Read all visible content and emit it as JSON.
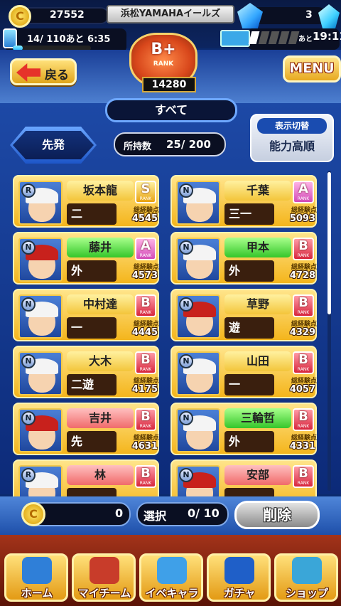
{
  "header": {
    "coins": "27552",
    "team_name": "浜松YAMAHAイールズ",
    "gems": "3",
    "stamina": "14/ 110あと 6:35",
    "stamina_fraction": 0.13,
    "ticket_prefix": "あと",
    "ticket_time": "19:11",
    "ticket_filled": 1,
    "ticket_total": 5,
    "back_label": "戻る",
    "menu_label": "MENU",
    "rank_letter": "B+",
    "rank_word": "RANK",
    "rank_score": "14280"
  },
  "filters": {
    "category": "すべて",
    "position": "先発",
    "owned_label": "所持数",
    "owned_value": "25/ 200",
    "toggle_label": "表示切替",
    "sort_label": "能力高順"
  },
  "players": [
    {
      "name": "坂本龍",
      "rank": "S",
      "pos": "二",
      "exp_label": "総経験点",
      "exp": "4545",
      "color": "yellow",
      "badge": "R"
    },
    {
      "name": "千葉",
      "rank": "A",
      "pos": "三一",
      "exp_label": "総経験点",
      "exp": "5093",
      "color": "yellow",
      "badge": "N"
    },
    {
      "name": "藤井",
      "rank": "A",
      "pos": "外",
      "exp_label": "総経験点",
      "exp": "4573",
      "color": "green",
      "badge": "N"
    },
    {
      "name": "甲本",
      "rank": "B",
      "pos": "外",
      "exp_label": "総経験点",
      "exp": "4728",
      "color": "green",
      "badge": "N"
    },
    {
      "name": "中村達",
      "rank": "B",
      "pos": "一",
      "exp_label": "総経験点",
      "exp": "4445",
      "color": "yellow",
      "badge": "N"
    },
    {
      "name": "草野",
      "rank": "B",
      "pos": "遊",
      "exp_label": "総経験点",
      "exp": "4329",
      "color": "yellow",
      "badge": "N"
    },
    {
      "name": "大木",
      "rank": "B",
      "pos": "二遊",
      "exp_label": "総経験点",
      "exp": "4175",
      "color": "yellow",
      "badge": "N"
    },
    {
      "name": "山田",
      "rank": "B",
      "pos": "一",
      "exp_label": "総経験点",
      "exp": "4057",
      "color": "yellow",
      "badge": "N"
    },
    {
      "name": "吉井",
      "rank": "B",
      "pos": "先",
      "exp_label": "総経験点",
      "exp": "4631",
      "color": "red",
      "badge": "N"
    },
    {
      "name": "三輪哲",
      "rank": "B",
      "pos": "外",
      "exp_label": "総経験点",
      "exp": "4331",
      "color": "green",
      "badge": "N"
    },
    {
      "name": "林",
      "rank": "B",
      "pos": "",
      "exp_label": "",
      "exp": "",
      "color": "red",
      "badge": "R"
    },
    {
      "name": "安部",
      "rank": "B",
      "pos": "",
      "exp_label": "",
      "exp": "",
      "color": "red",
      "badge": "N"
    }
  ],
  "rank_sub": "RANK",
  "action_bar": {
    "coins": "0",
    "select_label": "選択",
    "select_value": "0/ 10",
    "delete_label": "削除"
  },
  "nav": [
    {
      "label": "ホーム",
      "icon": "book-icon"
    },
    {
      "label": "マイチーム",
      "icon": "team-icon"
    },
    {
      "label": "イベキャラ",
      "icon": "event-character-icon"
    },
    {
      "label": "ガチャ",
      "icon": "gacha-icon"
    },
    {
      "label": "ショップ",
      "icon": "shop-icon"
    }
  ]
}
